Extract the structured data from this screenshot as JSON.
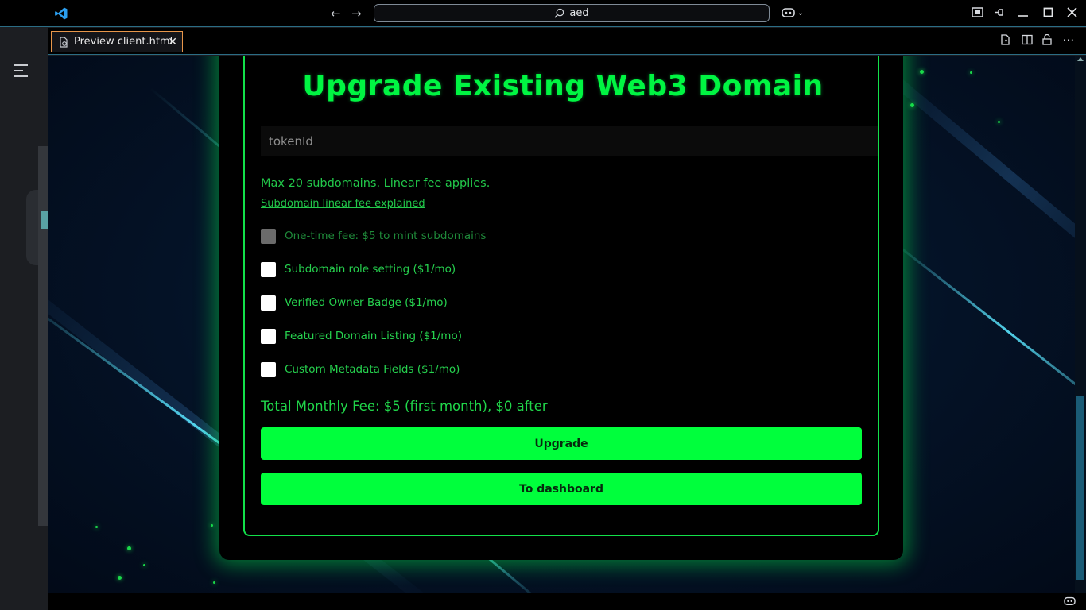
{
  "titlebar": {
    "search_text": "aed",
    "icons": [
      "vscode-logo-icon",
      "back-arrow-icon",
      "forward-arrow-icon",
      "search-icon",
      "copilot-icon",
      "chevron-down-icon",
      "layout-icon",
      "pin-icon",
      "minimize-icon",
      "maximize-icon",
      "close-icon"
    ]
  },
  "tab": {
    "label": "Preview client.html",
    "close": "✕"
  },
  "editor_actions": [
    "open-file-icon",
    "split-editor-icon",
    "lock-icon",
    "more-actions-icon"
  ],
  "page": {
    "heading": "Upgrade Existing Web3 Domain",
    "token_placeholder": "tokenId",
    "note": "Max 20 subdomains. Linear fee applies.",
    "link": "Subdomain linear fee explained",
    "options": [
      {
        "label": "One-time fee: $5 to mint subdomains",
        "checked": false,
        "disabled": true
      },
      {
        "label": "Subdomain role setting ($1/mo)",
        "checked": false,
        "disabled": false
      },
      {
        "label": "Verified Owner Badge ($1/mo)",
        "checked": false,
        "disabled": false
      },
      {
        "label": "Featured Domain Listing ($1/mo)",
        "checked": false,
        "disabled": false
      },
      {
        "label": "Custom Metadata Fields ($1/mo)",
        "checked": false,
        "disabled": false
      }
    ],
    "total": "Total Monthly Fee: $5 (first month), $0 after",
    "upgrade_button": "Upgrade",
    "dashboard_button": "To dashboard"
  },
  "colors": {
    "accent": "#00ff3c",
    "text_green": "#22c84a",
    "panel_border": "#2b6d85"
  }
}
